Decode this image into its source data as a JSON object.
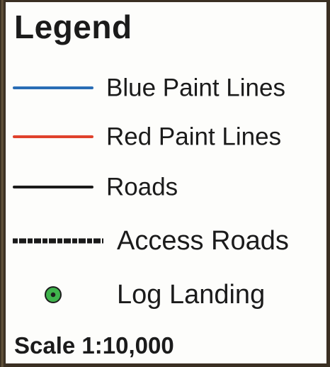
{
  "legend": {
    "title": "Legend",
    "items": [
      {
        "label": "Blue Paint Lines",
        "symbol": "line",
        "color": "#2a6db5"
      },
      {
        "label": "Red Paint Lines",
        "symbol": "line",
        "color": "#e0422c"
      },
      {
        "label": "Roads",
        "symbol": "line",
        "color": "#1b1b1b"
      },
      {
        "label": "Access Roads",
        "symbol": "dash-dot-line",
        "color": "#1b1b1b"
      },
      {
        "label": "Log Landing",
        "symbol": "green-dot",
        "color": "#3fb34c"
      }
    ],
    "scale": "Scale 1:10,000"
  }
}
